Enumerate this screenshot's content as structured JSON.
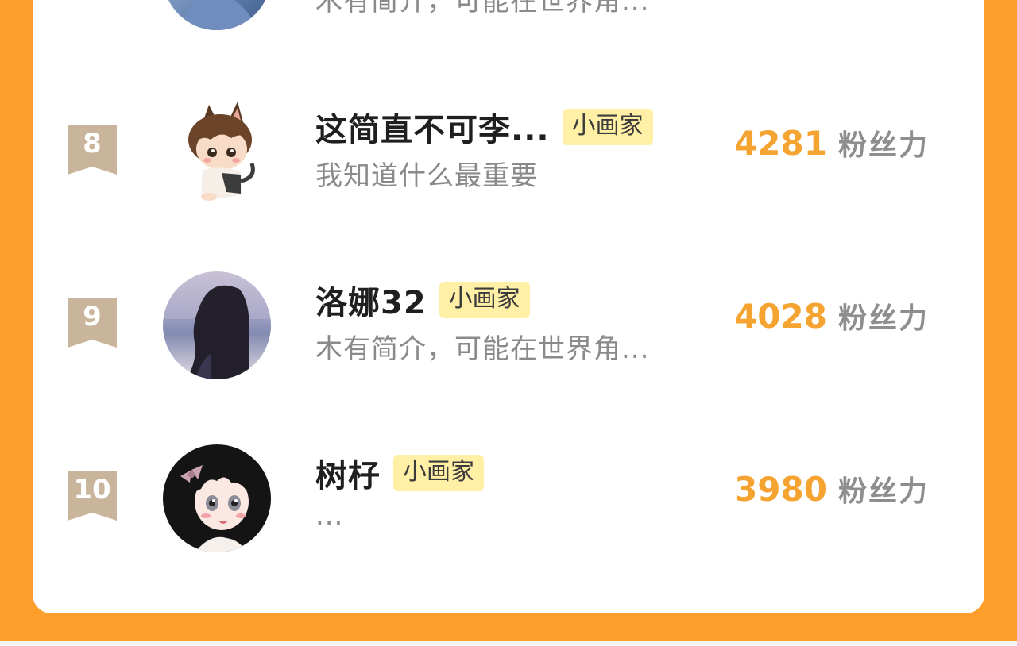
{
  "ranking": {
    "previous_row": {
      "bio": "木有简介，可能在世界角...",
      "avatar_colors": [
        "#7a9bcc",
        "#2e4a78"
      ]
    },
    "rows": [
      {
        "rank": "8",
        "name": "这简直不可李...",
        "tag": "小画家",
        "bio": "我知道什么最重要",
        "fans_count": "4281",
        "fans_label": "粉丝力",
        "avatar_icon": "cartoon-cat-boy-avatar"
      },
      {
        "rank": "9",
        "name": "洛娜32",
        "tag": "小画家",
        "bio": "木有简介，可能在世界角...",
        "fans_count": "4028",
        "fans_label": "粉丝力",
        "avatar_icon": "girl-by-sea-avatar"
      },
      {
        "rank": "10",
        "name": "树杍",
        "tag": "小画家",
        "bio": "...",
        "fans_count": "3980",
        "fans_label": "粉丝力",
        "avatar_icon": "anime-girl-avatar"
      }
    ]
  },
  "colors": {
    "background": "#FF9F2B",
    "accent_count": "#F5A431",
    "tag_bg": "#FFF0A6",
    "badge": "#C9B49C"
  }
}
